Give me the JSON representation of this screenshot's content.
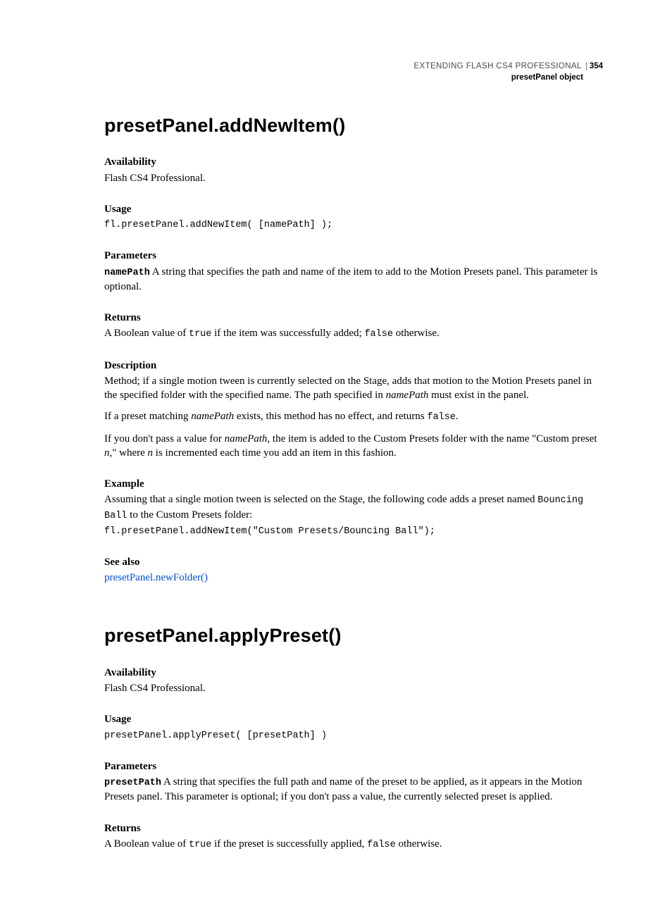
{
  "header": {
    "book_title": "EXTENDING FLASH CS4 PROFESSIONAL",
    "page_number": "354",
    "section": "presetPanel object"
  },
  "methods": [
    {
      "title": "presetPanel.addNewItem()",
      "availability_label": "Availability",
      "availability_text": "Flash CS4 Professional.",
      "usage_label": "Usage",
      "usage_code": "fl.presetPanel.addNewItem( [namePath] );",
      "parameters_label": "Parameters",
      "param_name": "namePath",
      "param_text": "  A string that specifies the path and name of the item to add to the Motion Presets panel. This parameter is optional.",
      "returns_label": "Returns",
      "returns_pre": "A Boolean value of ",
      "returns_true": "true",
      "returns_mid": " if the item was successfully added; ",
      "returns_false": "false",
      "returns_post": " otherwise.",
      "description_label": "Description",
      "desc_p1_a": "Method; if a single motion tween is currently selected on the Stage, adds that motion to the Motion Presets panel in the specified folder with the specified name. The path specified in ",
      "desc_p1_i": "namePath",
      "desc_p1_b": " must exist in the panel.",
      "desc_p2_a": "If a preset matching ",
      "desc_p2_i": "namePath",
      "desc_p2_b": " exists, this method has no effect, and returns ",
      "desc_p2_code": "false",
      "desc_p2_c": ".",
      "desc_p3_a": "If you don't pass a value for ",
      "desc_p3_i": "namePath",
      "desc_p3_b": ", the item is added to the Custom Presets folder with the name \"Custom preset ",
      "desc_p3_i2": "n",
      "desc_p3_c": ",\" where ",
      "desc_p3_i3": "n",
      "desc_p3_d": " is incremented each time you add an item in this fashion.",
      "example_label": "Example",
      "example_text_a": "Assuming that a single motion tween is selected on the Stage, the following code adds a preset named ",
      "example_code_inline": "Bouncing Ball",
      "example_text_b": " to the Custom Presets folder:",
      "example_code": "fl.presetPanel.addNewItem(\"Custom Presets/Bouncing Ball\");",
      "seealso_label": "See also",
      "seealso_link": "presetPanel.newFolder()"
    },
    {
      "title": "presetPanel.applyPreset()",
      "availability_label": "Availability",
      "availability_text": "Flash CS4 Professional.",
      "usage_label": "Usage",
      "usage_code": "presetPanel.applyPreset( [presetPath] )",
      "parameters_label": "Parameters",
      "param_name": "presetPath",
      "param_text": "  A string that specifies the full path and name of the preset to be applied, as it appears in the Motion Presets panel. This parameter is optional; if you don't pass a value, the currently selected preset is applied.",
      "returns_label": "Returns",
      "returns_pre": "A Boolean value of ",
      "returns_true": "true",
      "returns_mid": " if the preset is successfully applied, ",
      "returns_false": "false",
      "returns_post": " otherwise."
    }
  ]
}
